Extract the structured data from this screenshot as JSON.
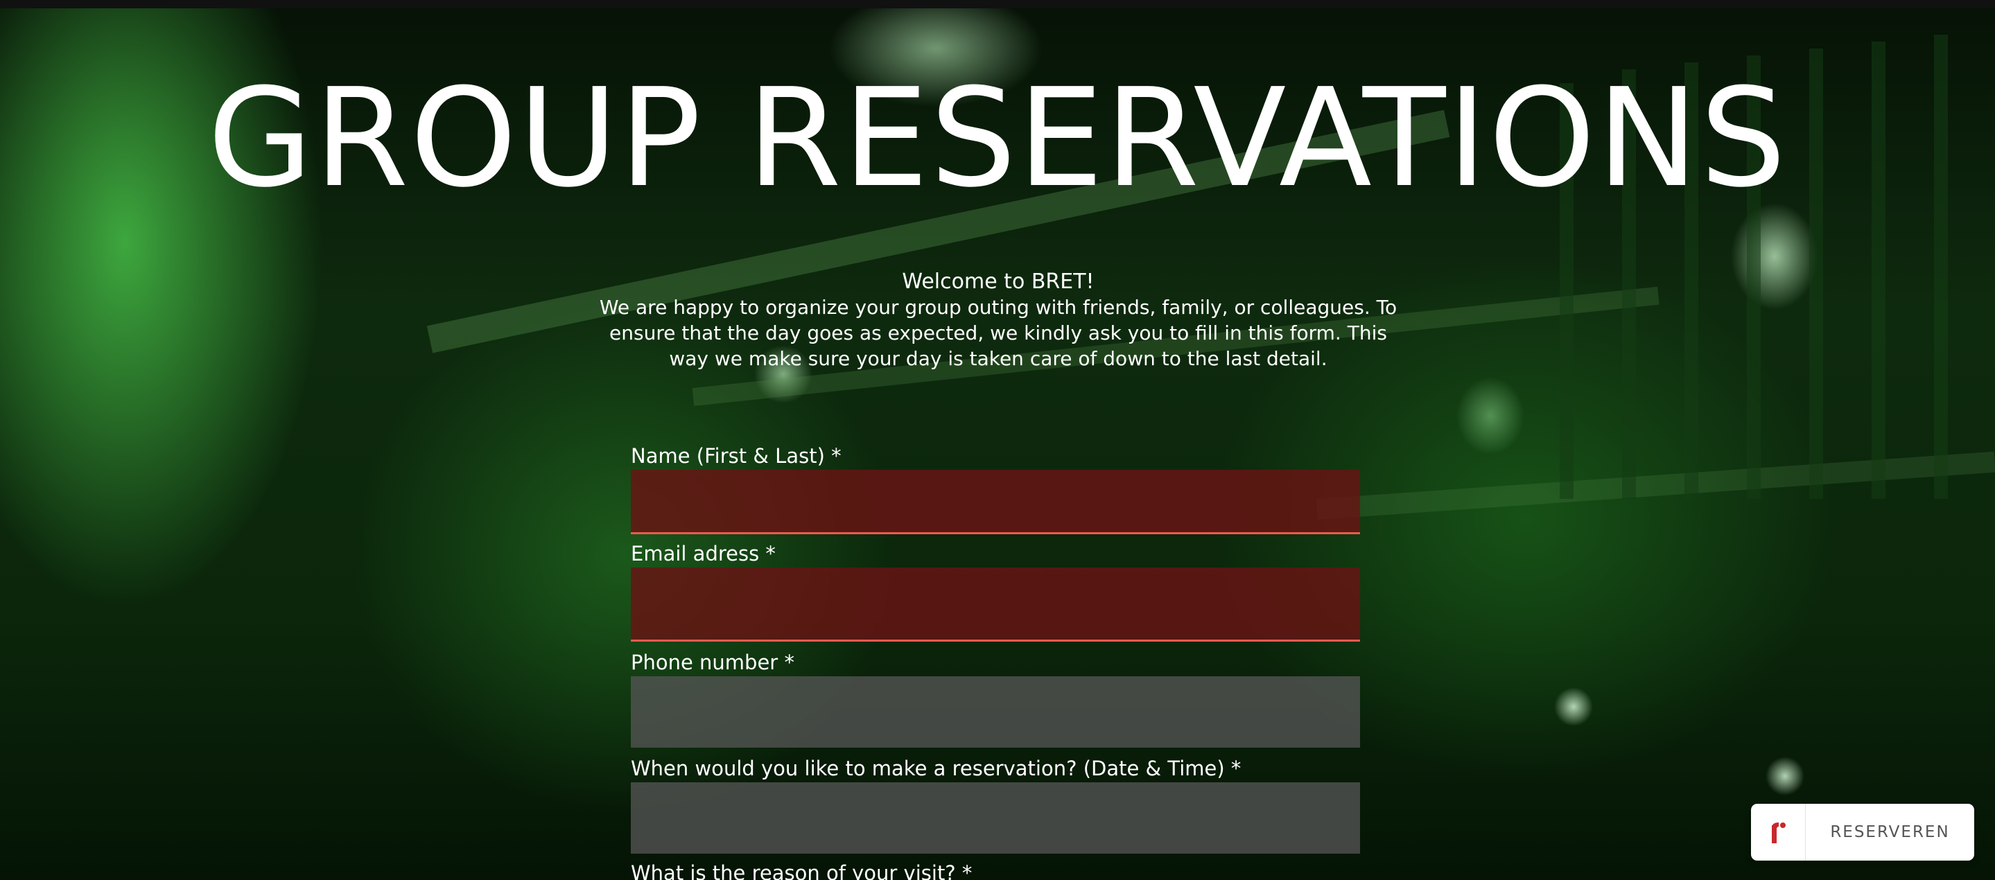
{
  "hero": {
    "title": "GROUP RESERVATIONS"
  },
  "intro": {
    "welcome": "Welcome to BRET!",
    "body": "We are happy to organize your group outing with friends, family, or colleagues. To ensure that the day goes as expected, we kindly ask you to fill in this form. This way we make sure your day is taken care of down to the last detail."
  },
  "form": {
    "fields": [
      {
        "label": "Name (First & Last) *",
        "value": "",
        "state": "error"
      },
      {
        "label": "Email adress *",
        "value": "",
        "state": "error"
      },
      {
        "label": "Phone number *",
        "value": "",
        "state": "normal"
      },
      {
        "label": "When would you like to make a reservation? (Date & Time) *",
        "value": "",
        "state": "normal"
      },
      {
        "label": "What is the reason of your visit? *",
        "value": "",
        "state": "normal"
      }
    ]
  },
  "widget": {
    "label": "RESERVEREN",
    "logo_icon": "reservation-logo-icon"
  },
  "colors": {
    "error_field_bg": "#6a1414",
    "error_underline": "#ee5a50",
    "field_bg": "#555555",
    "text": "#ffffff",
    "logo_red": "#c8282d"
  }
}
